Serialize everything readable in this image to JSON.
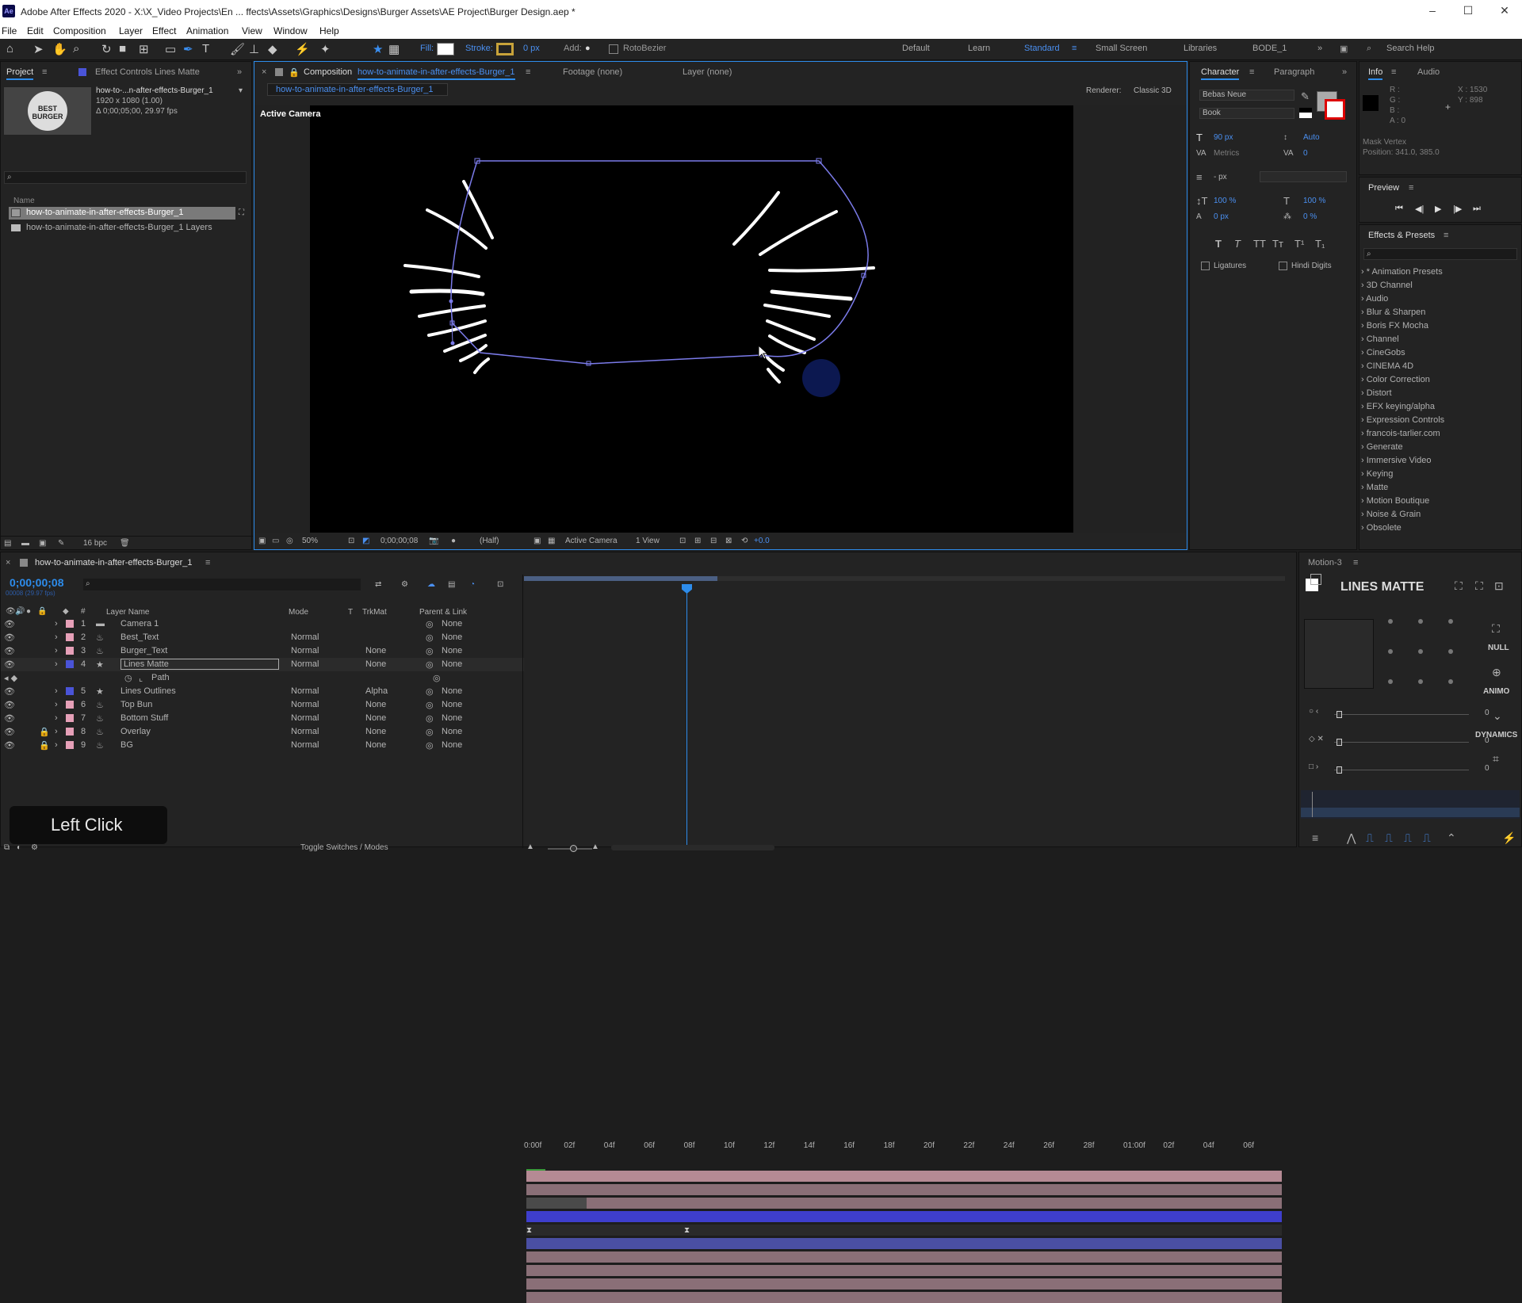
{
  "title": "Adobe After Effects 2020 - X:\\X_Video Projects\\En ... ffects\\Assets\\Graphics\\Designs\\Burger Assets\\AE Project\\Burger Design.aep *",
  "menu": [
    "File",
    "Edit",
    "Composition",
    "Layer",
    "Effect",
    "Animation",
    "View",
    "Window",
    "Help"
  ],
  "toolbar": {
    "fill_label": "Fill:",
    "stroke_label": "Stroke:",
    "stroke_px": "0 px",
    "add_label": "Add:",
    "rotobezier": "RotoBezier",
    "search": "Search Help"
  },
  "workspaces": [
    "Default",
    "Learn",
    "Standard",
    "Small Screen",
    "Libraries",
    "BODE_1"
  ],
  "project": {
    "tab": "Project",
    "effect_controls": "Effect Controls Lines Matte",
    "comp_name": "how-to-...n-after-effects-Burger_1",
    "comp_size": "1920 x 1080 (1.00)",
    "comp_dur": "Δ 0;00;05;00, 29.97 fps",
    "name_col": "Name",
    "items": [
      "how-to-animate-in-after-effects-Burger_1",
      "how-to-animate-in-after-effects-Burger_1 Layers"
    ],
    "bpc": "16 bpc"
  },
  "comp": {
    "tab_prefix": "Composition",
    "tab_name": "how-to-animate-in-after-effects-Burger_1",
    "footage": "Footage (none)",
    "layer": "Layer (none)",
    "flow_tab": "how-to-animate-in-after-effects-Burger_1",
    "renderer_label": "Renderer:",
    "renderer": "Classic 3D",
    "active_camera": "Active Camera",
    "zoom": "50%",
    "time": "0;00;00;08",
    "res": "(Half)",
    "view_cam": "Active Camera",
    "views": "1 View",
    "exposure": "+0.0"
  },
  "character": {
    "tab": "Character",
    "tab2": "Paragraph",
    "font": "Bebas Neue",
    "style": "Book",
    "size": "90 px",
    "leading": "Auto",
    "kerning": "Metrics",
    "tracking": "0",
    "stroke_w": "- px",
    "vscale": "100 %",
    "hscale": "100 %",
    "baseline": "0 px",
    "tsume": "0 %",
    "ligatures": "Ligatures",
    "hindi": "Hindi Digits"
  },
  "info": {
    "tab": "Info",
    "tab2": "Audio",
    "r": "R :",
    "g": "G :",
    "b": "B :",
    "a": "A : 0",
    "x": "X : 1530",
    "y": "Y : 898",
    "mask": "Mask Vertex",
    "position": "Position: 341.0, 385.0"
  },
  "preview": {
    "tab": "Preview"
  },
  "effects": {
    "tab": "Effects & Presets",
    "items": [
      "* Animation Presets",
      "3D Channel",
      "Audio",
      "Blur & Sharpen",
      "Boris FX Mocha",
      "Channel",
      "CineGobs",
      "CINEMA 4D",
      "Color Correction",
      "Distort",
      "EFX keying/alpha",
      "Expression Controls",
      "francois-tarlier.com",
      "Generate",
      "Immersive Video",
      "Keying",
      "Matte",
      "Motion Boutique",
      "Noise & Grain",
      "Obsolete"
    ]
  },
  "timeline": {
    "tab": "how-to-animate-in-after-effects-Burger_1",
    "timecode": "0;00;00;08",
    "frames": "00008 (29.97 fps)",
    "col_layer": "Layer Name",
    "col_mode": "Mode",
    "col_t": "T",
    "col_trk": "TrkMat",
    "col_parent": "Parent & Link",
    "ruler": [
      "0:00f",
      "02f",
      "04f",
      "06f",
      "08f",
      "10f",
      "12f",
      "14f",
      "16f",
      "18f",
      "20f",
      "22f",
      "24f",
      "26f",
      "28f",
      "01:00f",
      "02f",
      "04f",
      "06f"
    ],
    "toggle": "Toggle Switches / Modes",
    "layers": [
      {
        "num": "1",
        "name": "Camera 1",
        "mode": "",
        "trk": "",
        "parent": "None",
        "color": "#e6a0b8"
      },
      {
        "num": "2",
        "name": "Best_Text",
        "mode": "Normal",
        "trk": "",
        "parent": "None",
        "color": "#e6a0b8"
      },
      {
        "num": "3",
        "name": "Burger_Text",
        "mode": "Normal",
        "trk": "None",
        "parent": "None",
        "color": "#e6a0b8"
      },
      {
        "num": "4",
        "name": "Lines Matte",
        "mode": "Normal",
        "trk": "None",
        "parent": "None",
        "color": "#4a54d8"
      },
      {
        "num": "",
        "name": "Path",
        "mode": "",
        "trk": "",
        "parent": "",
        "color": ""
      },
      {
        "num": "5",
        "name": "Lines Outlines",
        "mode": "Normal",
        "trk": "Alpha",
        "parent": "None",
        "color": "#4a54d8"
      },
      {
        "num": "6",
        "name": "Top Bun",
        "mode": "Normal",
        "trk": "None",
        "parent": "None",
        "color": "#e6a0b8"
      },
      {
        "num": "7",
        "name": "Bottom Stuff",
        "mode": "Normal",
        "trk": "None",
        "parent": "None",
        "color": "#e6a0b8"
      },
      {
        "num": "8",
        "name": "Overlay",
        "mode": "Normal",
        "trk": "None",
        "parent": "None",
        "color": "#e6a0b8"
      },
      {
        "num": "9",
        "name": "BG",
        "mode": "Normal",
        "trk": "None",
        "parent": "None",
        "color": "#e6a0b8"
      }
    ]
  },
  "motion": {
    "tab": "Motion-3",
    "title": "LINES MATTE",
    "null": "NULL",
    "animo": "ANIMO",
    "dynamics": "DYNAMICS",
    "v1": "0",
    "v2": "0",
    "v3": "0"
  },
  "overlay_text": "Left Click",
  "colors": {
    "accent": "#2d8ceb",
    "layer_blue": "#3e3ecc",
    "layer_pink": "#c08a96",
    "mask": "#7b7bea"
  }
}
